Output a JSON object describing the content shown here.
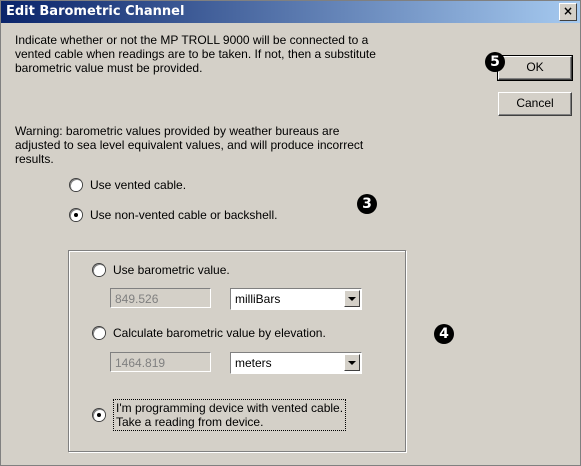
{
  "window": {
    "title": "Edit Barometric Channel",
    "close_glyph": "×"
  },
  "description": "Indicate whether or not the MP TROLL 9000 will be connected to a\nvented cable when readings are to be taken.  If not, then a substitute\nbarometric value must be provided.",
  "warning": "Warning:  barometric values provided by weather bureaus are\nadjusted to sea level equivalent values, and will produce incorrect\nresults.",
  "buttons": {
    "ok": "OK",
    "cancel": "Cancel"
  },
  "cable_options": [
    {
      "label": "Use vented cable.",
      "checked": false
    },
    {
      "label": "Use non-vented cable or backshell.",
      "checked": true
    }
  ],
  "group": {
    "barometric_option": {
      "label": "Use barometric value.",
      "checked": false
    },
    "barometric_value": "849.526",
    "barometric_unit": "milliBars",
    "elevation_option": {
      "label": "Calculate barometric value by elevation.",
      "checked": false
    },
    "elevation_value": "1464.819",
    "elevation_unit": "meters",
    "device_option": {
      "label": "I'm programming device with vented cable.\nTake a reading from device.",
      "checked": true
    }
  },
  "badges": {
    "b3": "3",
    "b4": "4",
    "b5": "5"
  }
}
